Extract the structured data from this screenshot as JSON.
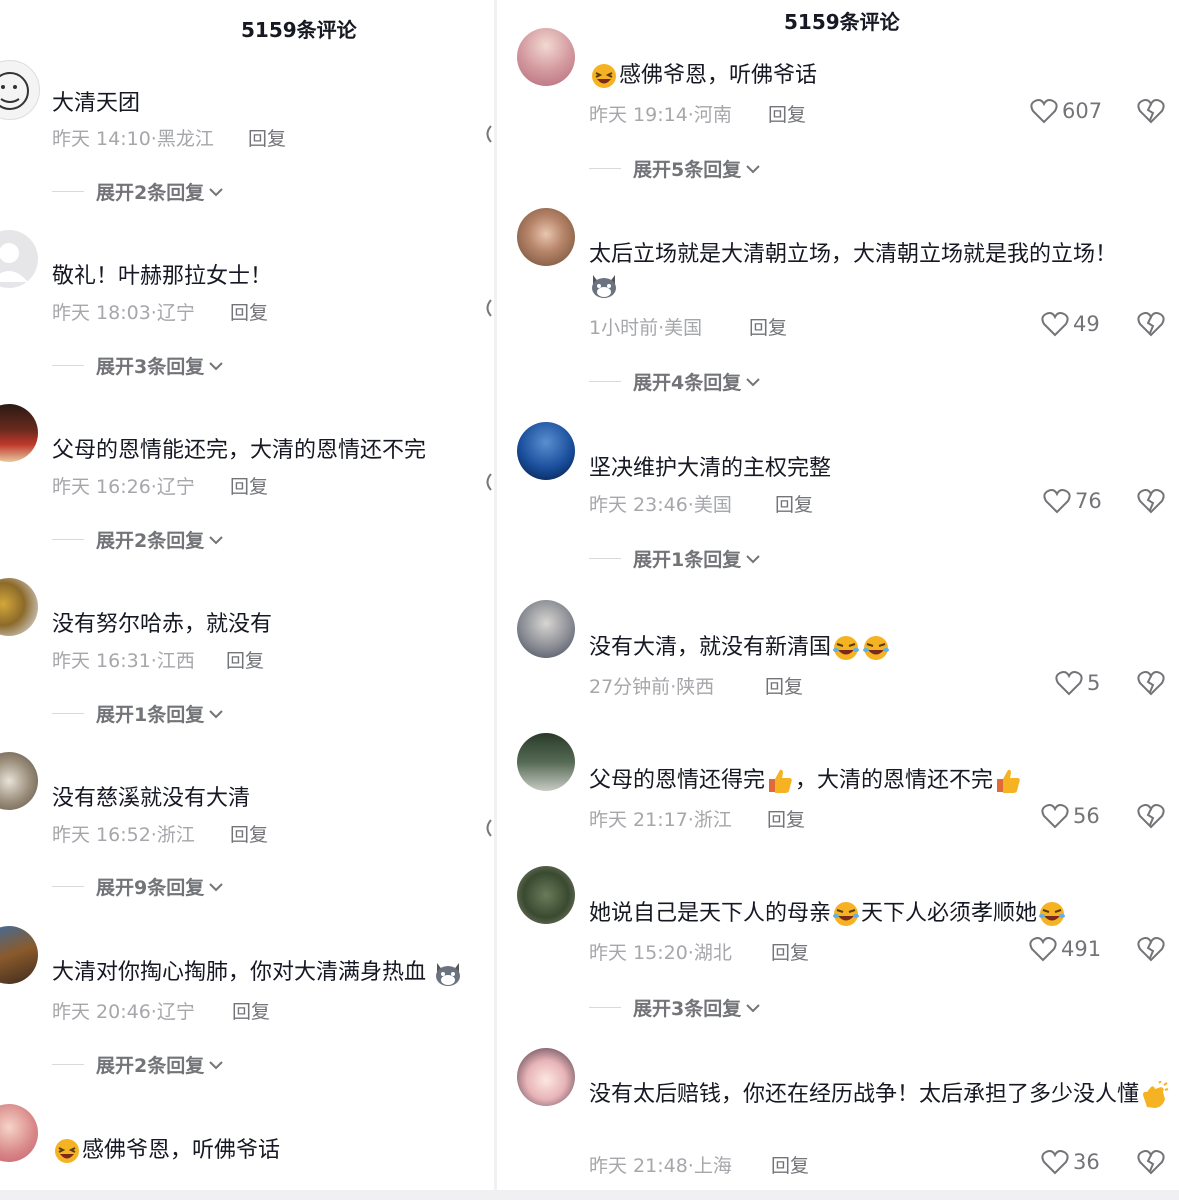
{
  "left": {
    "header": "5159条评论",
    "comments": [
      {
        "username": "",
        "text": "大清天团",
        "time": "昨天 14:10",
        "location": "黑龙江",
        "reply": "回复",
        "expand": "展开2条回复"
      },
      {
        "username": "",
        "text": "敬礼！叶赫那拉女士！",
        "time": "昨天 18:03",
        "location": "辽宁",
        "reply": "回复",
        "expand": "展开3条回复"
      },
      {
        "username": "",
        "text": "父母的恩情能还完，大清的恩情还不完",
        "time": "昨天 16:26",
        "location": "辽宁",
        "reply": "回复",
        "expand": "展开2条回复"
      },
      {
        "username": "",
        "text": "没有努尔哈赤，就没有",
        "time": "昨天 16:31",
        "location": "江西",
        "reply": "回复",
        "expand": "展开1条回复"
      },
      {
        "username": "",
        "text": "没有慈溪就没有大清",
        "time": "昨天 16:52",
        "location": "浙江",
        "reply": "回复",
        "expand": "展开9条回复"
      },
      {
        "username": "",
        "text": "大清对你掏心掏肺，你对大清满身热血",
        "time": "昨天 20:46",
        "location": "辽宁",
        "reply": "回复",
        "expand": "展开2条回复"
      },
      {
        "username": "",
        "text": "感佛爷恩，听佛爷话",
        "time": "",
        "location": "",
        "reply": "",
        "expand": ""
      }
    ]
  },
  "right": {
    "header": "5159条评论",
    "comments": [
      {
        "username": "",
        "text": "感佛爷恩，听佛爷话",
        "time": "昨天 19:14",
        "location": "河南",
        "reply": "回复",
        "likes": "607",
        "expand": "展开5条回复"
      },
      {
        "username": "",
        "text": "太后立场就是大清朝立场，大清朝立场就是我的立场！",
        "time": "1小时前",
        "location": "美国",
        "reply": "回复",
        "likes": "49",
        "expand": "展开4条回复"
      },
      {
        "username": "",
        "text": "坚决维护大清的主权完整",
        "time": "昨天 23:46",
        "location": "美国",
        "reply": "回复",
        "likes": "76",
        "expand": "展开1条回复"
      },
      {
        "username": "",
        "text": "没有大清，就没有新清国",
        "time": "27分钟前",
        "location": "陕西",
        "reply": "回复",
        "likes": "5",
        "expand": ""
      },
      {
        "username": "",
        "text_a": "父母的恩情还得完",
        "text_b": "，大清的恩情还不完",
        "time": "昨天 21:17",
        "location": "浙江",
        "reply": "回复",
        "likes": "56",
        "expand": ""
      },
      {
        "username": "",
        "text_a": "她说自己是天下人的母亲",
        "text_b": "天下人必须孝顺她",
        "time": "昨天 15:20",
        "location": "湖北",
        "reply": "回复",
        "likes": "491",
        "expand": "展开3条回复"
      },
      {
        "username": "",
        "text": "没有太后赔钱，你还在经历战争！太后承担了多少没人懂",
        "time": "昨天 21:48",
        "location": "上海",
        "reply": "回复",
        "likes": "36",
        "expand": ""
      }
    ]
  },
  "colors": {
    "text": "#161823",
    "meta": "#a6a7ab",
    "reply": "#737478"
  }
}
